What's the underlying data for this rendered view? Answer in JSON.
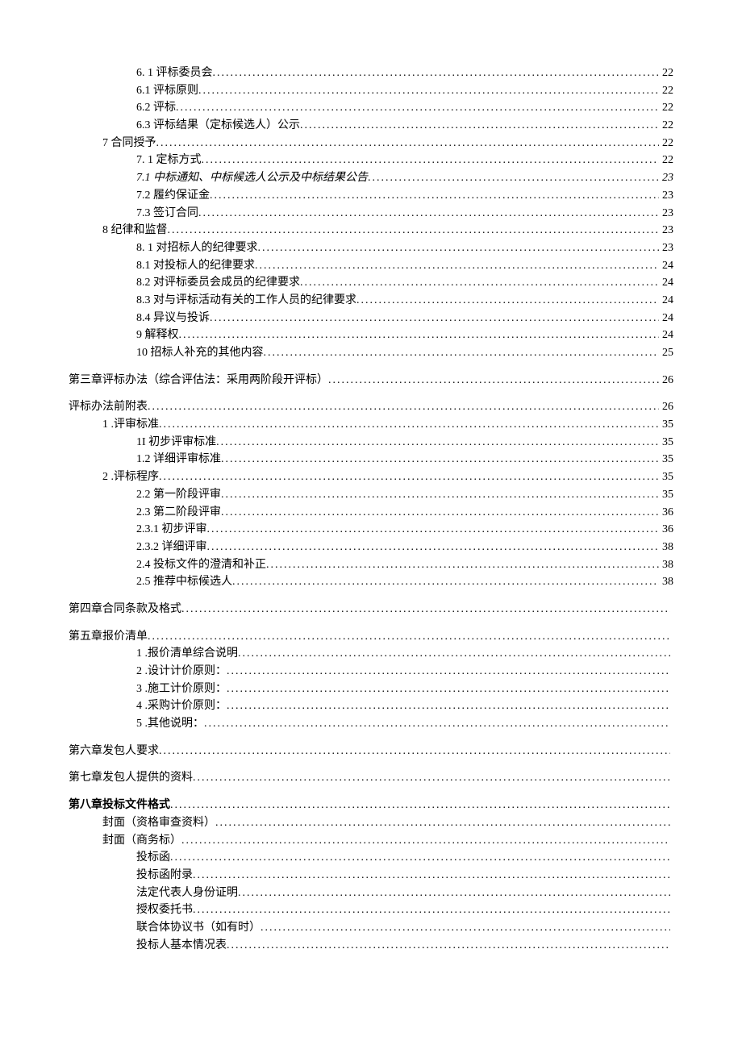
{
  "toc": [
    {
      "indent": 2,
      "label": "6.  1 评标委员会",
      "page": "22",
      "gap": false
    },
    {
      "indent": 2,
      "label": "6.1    评标原则",
      "page": "22"
    },
    {
      "indent": 2,
      "label": "6.2    评标",
      "page": "22"
    },
    {
      "indent": 2,
      "label": "6.3    评标结果（定标候选人）公示",
      "page": "22"
    },
    {
      "indent": 1,
      "label": "7 合同授予",
      "page": "22"
    },
    {
      "indent": 2,
      "label": "7.  1 定标方式",
      "page": "22"
    },
    {
      "indent": 2,
      "label": "7.1    中标通知、中标候选人公示及中标结果公告",
      "page": "23",
      "italic": true
    },
    {
      "indent": 2,
      "label": "7.2    履约保证金",
      "page": "23"
    },
    {
      "indent": 2,
      "label": "7.3    签订合同",
      "page": "23"
    },
    {
      "indent": 1,
      "label": "8 纪律和监督",
      "page": "23"
    },
    {
      "indent": 2,
      "label": "8.  1 对招标人的纪律要求   ",
      "page": "23"
    },
    {
      "indent": 2,
      "label": "8.1    对投标人的纪律要求    ",
      "page": "24"
    },
    {
      "indent": 2,
      "label": "8.2    对评标委员会成员的纪律要求",
      "page": "24"
    },
    {
      "indent": 2,
      "label": "8.3    对与评标活动有关的工作人员的纪律要求",
      "page": "24"
    },
    {
      "indent": 2,
      "label": "8.4    异议与投诉",
      "page": "24"
    },
    {
      "indent": 2,
      "label": "9 解释权",
      "page": "24"
    },
    {
      "indent": 2,
      "label": "10 招标人补充的其他内容    ",
      "page": "25"
    },
    {
      "indent": 0,
      "label": "第三章评标办法（综合评估法：采用两阶段开评标）",
      "page": "26",
      "gap": true
    },
    {
      "indent": 0,
      "label": "评标办法前附表",
      "page": "26",
      "gap": true
    },
    {
      "indent": 1,
      "label": "1   .评审标准",
      "page": "35"
    },
    {
      "indent": 2,
      "label": "1I 初步评审标准",
      "page": "35"
    },
    {
      "indent": 2,
      "label": "1.2 详细评审标准",
      "page": "35"
    },
    {
      "indent": 1,
      "label": "2   .评标程序",
      "page": "35"
    },
    {
      "indent": 2,
      "label": "2.2   第一阶段评审",
      "page": "35"
    },
    {
      "indent": 2,
      "label": "2.3   第二阶段评审",
      "page": "36"
    },
    {
      "indent": 2,
      "label": "2.3.1   初步评审",
      "page": "36"
    },
    {
      "indent": 2,
      "label": "2.3.2   详细评审",
      "page": "38"
    },
    {
      "indent": 2,
      "label": "2.4   投标文件的澄清和补正",
      "page": "38"
    },
    {
      "indent": 2,
      "label": "2.5   推荐中标候选人",
      "page": "38"
    },
    {
      "indent": 0,
      "label": "第四章合同条款及格式",
      "page": "",
      "gap": true
    },
    {
      "indent": 0,
      "label": "第五章报价清单",
      "page": "",
      "gap": true
    },
    {
      "indent": 2,
      "label": "1   .报价清单综合说明",
      "page": ""
    },
    {
      "indent": 2,
      "label": "2   .设计计价原则：",
      "page": ""
    },
    {
      "indent": 2,
      "label": "3   .施工计价原则：",
      "page": ""
    },
    {
      "indent": 2,
      "label": "4   .采购计价原则：",
      "page": ""
    },
    {
      "indent": 2,
      "label": "5   .其他说明：",
      "page": ""
    },
    {
      "indent": 0,
      "label": "第六章发包人要求",
      "page": "",
      "gap": true
    },
    {
      "indent": 0,
      "label": "第七章发包人提供的资料",
      "page": "",
      "gap": true
    },
    {
      "indent": 0,
      "label": "第八章投标文件格式",
      "page": "",
      "gap": true,
      "bold": true
    },
    {
      "indent": 1,
      "label": "封面（资格审查资料）",
      "page": ""
    },
    {
      "indent": 1,
      "label": "封面（商务标）",
      "page": ""
    },
    {
      "indent": 2,
      "label": "投标函",
      "page": ""
    },
    {
      "indent": 2,
      "label": "投标函附录",
      "page": ""
    },
    {
      "indent": 2,
      "label": "法定代表人身份证明",
      "page": ""
    },
    {
      "indent": 2,
      "label": "授权委托书",
      "page": ""
    },
    {
      "indent": 2,
      "label": "联合体协议书（如有时）",
      "page": ""
    },
    {
      "indent": 2,
      "label": "投标人基本情况表",
      "page": ""
    }
  ]
}
